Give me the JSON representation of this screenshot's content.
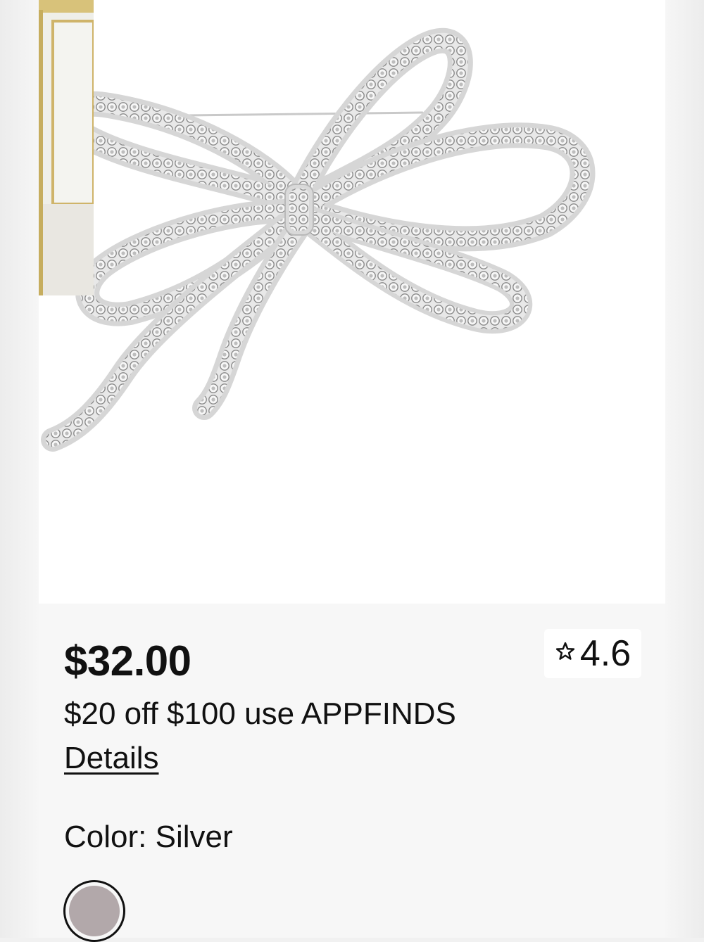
{
  "product": {
    "price": "$32.00",
    "promo": "$20 off $100 use APPFINDS",
    "details_link": "Details",
    "color_label": "Color: Silver",
    "rating": {
      "icon": "star-outline-icon",
      "value": "4.6"
    },
    "swatch": {
      "name": "Silver",
      "color": "#b2a8aa",
      "selected": true
    },
    "image": {
      "subject": "bow-brooch"
    }
  }
}
